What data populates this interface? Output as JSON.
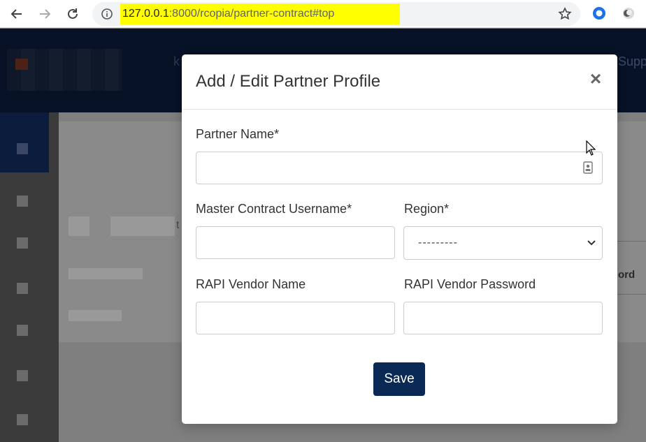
{
  "browser": {
    "url_host": "127.0.0.1",
    "url_path": ":8000/rcopia/partner-contract#top"
  },
  "background": {
    "header_letter": "k",
    "header_right_text": "Supp",
    "column_text": "t",
    "column_header": "ord"
  },
  "modal": {
    "title": "Add / Edit Partner Profile",
    "close_symbol": "×",
    "fields": {
      "partner_name": {
        "label": "Partner Name*",
        "value": ""
      },
      "master_contract_username": {
        "label": "Master Contract Username*",
        "value": ""
      },
      "region": {
        "label": "Region*",
        "selected": "---------"
      },
      "rapi_vendor_name": {
        "label": "RAPI Vendor Name",
        "value": ""
      },
      "rapi_vendor_password": {
        "label": "RAPI Vendor Password",
        "value": ""
      }
    },
    "save_label": "Save"
  },
  "colors": {
    "app_header": "#0d2147",
    "primary_button": "#0a2a55",
    "url_highlight": "#ffff00"
  }
}
